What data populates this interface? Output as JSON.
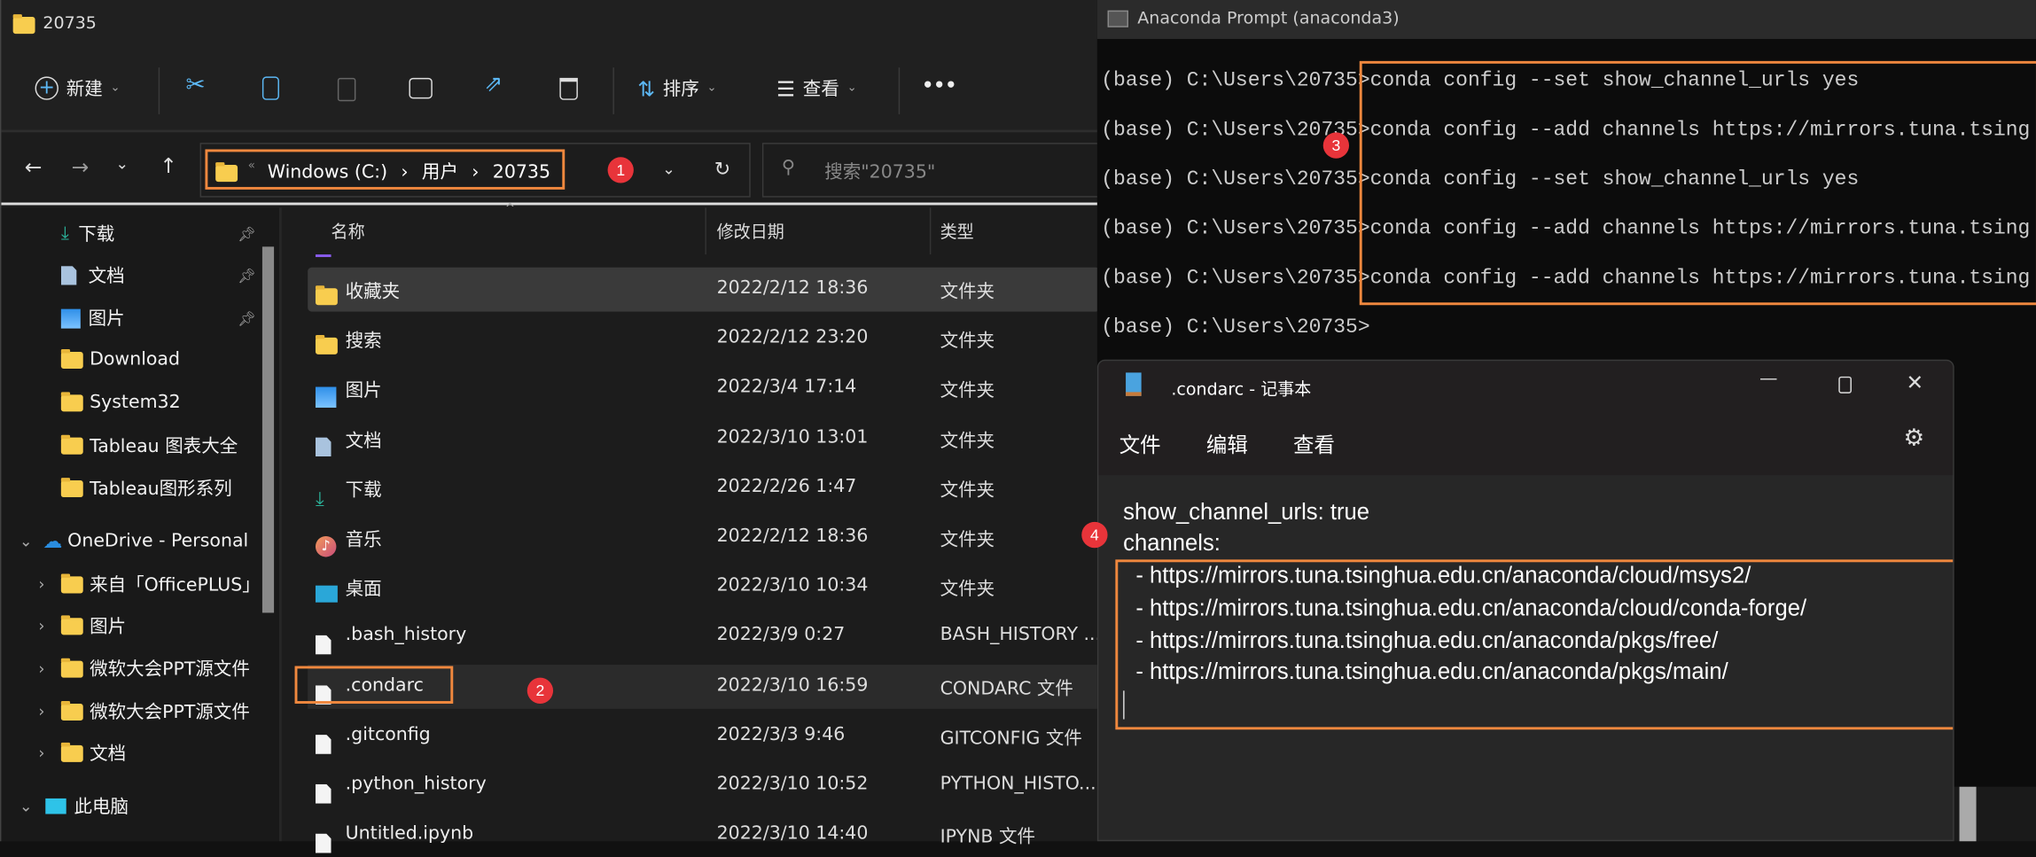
{
  "explorer": {
    "title": "20735",
    "toolbar": {
      "new_label": "新建",
      "sort_label": "排序",
      "view_label": "查看",
      "more_label": "•••"
    },
    "address": {
      "overflow": "«",
      "crumbs": [
        "Windows (C:)",
        "用户",
        "20735"
      ],
      "separator": "›"
    },
    "search_placeholder": "搜索\"20735\"",
    "sidebar": {
      "quick": [
        {
          "label": "下载",
          "icon": "download-icon",
          "pinned": true
        },
        {
          "label": "文档",
          "icon": "document-icon",
          "pinned": true
        },
        {
          "label": "图片",
          "icon": "pictures-icon",
          "pinned": true
        },
        {
          "label": "Download",
          "icon": "folder-icon"
        },
        {
          "label": "System32",
          "icon": "folder-icon"
        },
        {
          "label": "Tableau 图表大全",
          "icon": "folder-icon"
        },
        {
          "label": "Tableau图形系列",
          "icon": "folder-icon"
        }
      ],
      "onedrive": {
        "label": "OneDrive - Personal",
        "children": [
          "来自「OfficePLUS」",
          "图片",
          "微软大会PPT源文件",
          "微软大会PPT源文件",
          "文档"
        ]
      },
      "thispc": {
        "label": "此电脑"
      }
    },
    "columns": [
      "名称",
      "修改日期",
      "类型"
    ],
    "files": [
      {
        "name": "收藏夹",
        "date": "2022/2/12 18:36",
        "type": "文件夹",
        "icon": "folder"
      },
      {
        "name": "搜索",
        "date": "2022/2/12 23:20",
        "type": "文件夹",
        "icon": "folder"
      },
      {
        "name": "图片",
        "date": "2022/3/4 17:14",
        "type": "文件夹",
        "icon": "pictures"
      },
      {
        "name": "文档",
        "date": "2022/3/10 13:01",
        "type": "文件夹",
        "icon": "document"
      },
      {
        "name": "下载",
        "date": "2022/2/26 1:47",
        "type": "文件夹",
        "icon": "download"
      },
      {
        "name": "音乐",
        "date": "2022/2/12 18:36",
        "type": "文件夹",
        "icon": "music"
      },
      {
        "name": "桌面",
        "date": "2022/3/10 10:34",
        "type": "文件夹",
        "icon": "desktop"
      },
      {
        "name": ".bash_history",
        "date": "2022/3/9 0:27",
        "type": "BASH_HISTORY ...",
        "icon": "file"
      },
      {
        "name": ".condarc",
        "date": "2022/3/10 16:59",
        "type": "CONDARC 文件",
        "icon": "file"
      },
      {
        "name": ".gitconfig",
        "date": "2022/3/3 9:46",
        "type": "GITCONFIG 文件",
        "icon": "file"
      },
      {
        "name": ".python_history",
        "date": "2022/3/10 10:52",
        "type": "PYTHON_HISTO...",
        "icon": "file"
      },
      {
        "name": "Untitled.ipynb",
        "date": "2022/3/10 14:40",
        "type": "IPYNB 文件",
        "icon": "file"
      }
    ]
  },
  "terminal": {
    "title": "Anaconda Prompt (anaconda3)",
    "lines": [
      "(base) C:\\Users\\20735>conda config --set show_channel_urls yes",
      "(base) C:\\Users\\20735>conda config --add channels https://mirrors.tuna.tsing",
      "(base) C:\\Users\\20735>conda config --set show_channel_urls yes",
      "(base) C:\\Users\\20735>conda config --add channels https://mirrors.tuna.tsing",
      "(base) C:\\Users\\20735>conda config --add channels https://mirrors.tuna.tsing",
      "(base) C:\\Users\\20735>"
    ]
  },
  "notepad": {
    "title": ".condarc - 记事本",
    "menu": [
      "文件",
      "编辑",
      "查看"
    ],
    "content": [
      "show_channel_urls: true",
      "channels:",
      "  - https://mirrors.tuna.tsinghua.edu.cn/anaconda/cloud/msys2/",
      "  - https://mirrors.tuna.tsinghua.edu.cn/anaconda/cloud/conda-forge/",
      "  - https://mirrors.tuna.tsinghua.edu.cn/anaconda/pkgs/free/",
      "  - https://mirrors.tuna.tsinghua.edu.cn/anaconda/pkgs/main/"
    ]
  },
  "annotations": {
    "badges": [
      "1",
      "2",
      "3",
      "4"
    ],
    "highlight_color": "#f0883e",
    "badge_color": "#e8343a"
  }
}
